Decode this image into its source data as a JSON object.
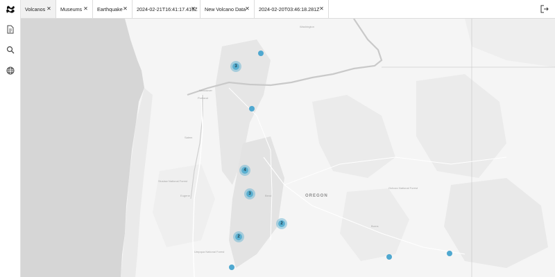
{
  "app": {
    "logo_icon": "honeycomb-logo-icon"
  },
  "rail": {
    "icons": [
      "document-icon",
      "search-icon",
      "globe-icon"
    ]
  },
  "tabs": [
    {
      "label": "Volcanos",
      "active": true
    },
    {
      "label": "Museums",
      "active": false
    },
    {
      "label": "Earthquake",
      "active": false
    },
    {
      "label": "2024-02-21T16:41:17.419Z",
      "active": false
    },
    {
      "label": "New Volcano Data",
      "active": false
    },
    {
      "label": "2024-02-20T03:46:18.281Z",
      "active": false
    }
  ],
  "header": {
    "logout_icon": "logout-icon"
  },
  "map": {
    "state_label": "OREGON",
    "place_labels": {
      "portland": "Portland",
      "salem": "Salem",
      "eugene": "Eugene",
      "bend": "Bend",
      "washington": "Washington",
      "vancouver": "Vancouver",
      "ochoco": "Ochoco National Forest",
      "umpqua": "Umpqua National Forest",
      "siuslaw": "Siuslaw National Forest",
      "burns": "Burns"
    },
    "clusters": [
      {
        "id": "c1",
        "count": "3"
      },
      {
        "id": "c2",
        "count": "4"
      },
      {
        "id": "c3",
        "count": "3"
      },
      {
        "id": "c4",
        "count": "2"
      },
      {
        "id": "c5",
        "count": "2"
      }
    ],
    "marker_color": "#4fa8d0"
  }
}
